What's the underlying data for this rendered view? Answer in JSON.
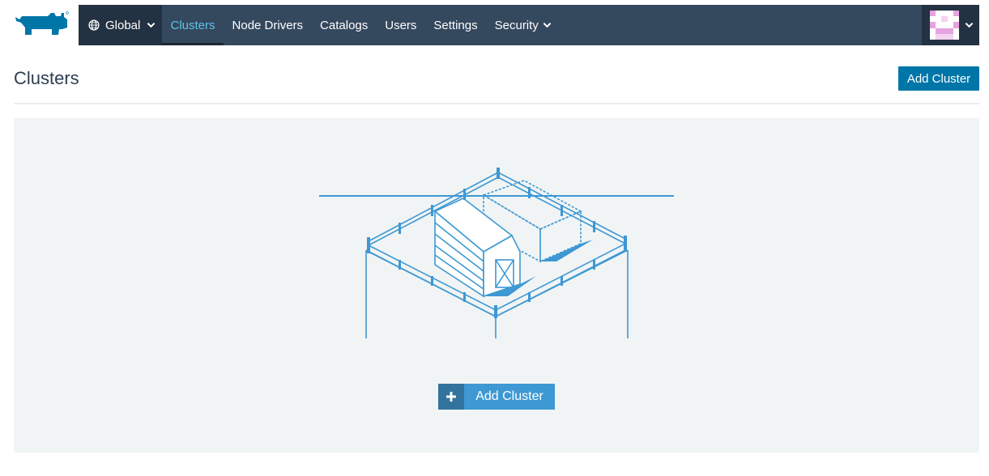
{
  "colors": {
    "nav_bg": "#34485e",
    "nav_dark": "#233242",
    "active_link": "#5ec4ea",
    "primary": "#0075a8",
    "illustration": "#3d98d3",
    "empty_bg": "#f1f4f5"
  },
  "header": {
    "logo_icon": "rancher-cow-logo",
    "scope": {
      "icon": "globe-icon",
      "label": "Global"
    },
    "nav": [
      {
        "label": "Clusters",
        "active": true
      },
      {
        "label": "Node Drivers",
        "active": false
      },
      {
        "label": "Catalogs",
        "active": false
      },
      {
        "label": "Users",
        "active": false
      },
      {
        "label": "Settings",
        "active": false
      },
      {
        "label": "Security",
        "active": false,
        "dropdown": true
      }
    ],
    "user": {
      "avatar_icon": "identicon-avatar"
    }
  },
  "page": {
    "title": "Clusters",
    "add_button": "Add Cluster"
  },
  "empty_state": {
    "illustration": "barn-farm-illustration",
    "add_button": "Add Cluster",
    "add_icon": "plus-icon"
  }
}
